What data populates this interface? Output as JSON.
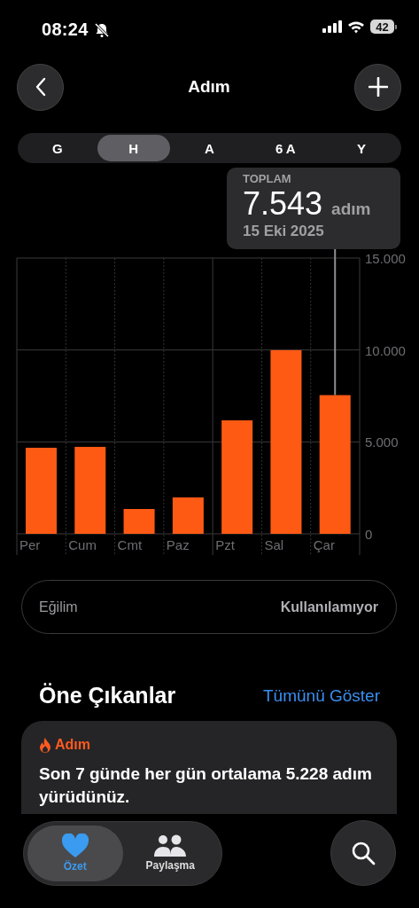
{
  "status_bar": {
    "time": "08:24",
    "battery": "42"
  },
  "header": {
    "title": "Adım"
  },
  "ranges": [
    {
      "label": "G",
      "selected": false
    },
    {
      "label": "H",
      "selected": true
    },
    {
      "label": "A",
      "selected": false
    },
    {
      "label": "6 A",
      "selected": false
    },
    {
      "label": "Y",
      "selected": false
    }
  ],
  "tooltip": {
    "label": "TOPLAM",
    "value": "7.543",
    "unit": "adım",
    "date": "15 Eki 2025"
  },
  "chart_data": {
    "type": "bar",
    "categories": [
      "Per",
      "Cum",
      "Cmt",
      "Paz",
      "Pzt",
      "Sal",
      "Çar"
    ],
    "series": [
      {
        "color": "#ff5a14",
        "values": [
          4680,
          4730,
          1350,
          1980,
          6170,
          9990,
          7543
        ]
      }
    ],
    "ylim": [
      0,
      15000
    ],
    "yticks": [
      {
        "value": 0,
        "label": "0"
      },
      {
        "value": 5000,
        "label": "5.000"
      },
      {
        "value": 10000,
        "label": "10.000"
      },
      {
        "value": 15000,
        "label": "15.000"
      }
    ],
    "annotations": [
      {
        "x": "Çar"
      }
    ]
  },
  "trend": {
    "label": "Eğilim",
    "value": "Kullanılamıyor"
  },
  "highlights": {
    "title": "Öne Çıkanlar",
    "link": "Tümünü Göster",
    "card": {
      "category": "Adım",
      "text": "Son 7 günde her gün ortalama 5.228 adım yürüdünüz."
    }
  },
  "tab_bar": {
    "tabs": [
      {
        "label": "Özet",
        "kind": "heart",
        "selected": true
      },
      {
        "label": "Paylaşma",
        "kind": "people",
        "selected": false
      }
    ]
  }
}
